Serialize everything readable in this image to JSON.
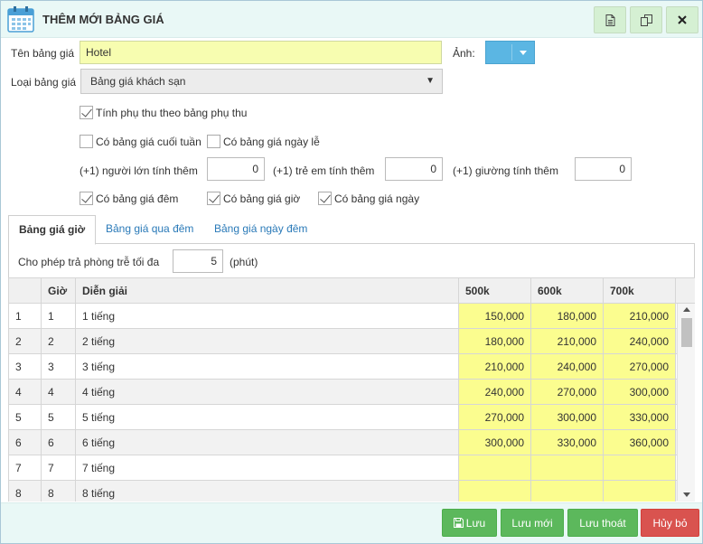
{
  "dialog": {
    "title": "THÊM MỚI BẢNG GIÁ",
    "icons": [
      "calendar-icon",
      "document-icon",
      "copy-icon",
      "close-icon"
    ]
  },
  "form": {
    "name_label": "Tên bảng giá",
    "name_value": "Hotel",
    "image_label": "Ảnh:",
    "type_label": "Loại bảng giá",
    "type_value": "Bảng giá khách sạn",
    "surcharge_label": "Tính phụ thu theo bảng phụ thu",
    "surcharge_checked": true,
    "weekend_label": "Có bảng giá cuối tuần",
    "weekend_checked": false,
    "holiday_label": "Có bảng giá ngày lễ",
    "holiday_checked": false,
    "extra_adult_label": "(+1) người lớn tính thêm",
    "extra_adult_value": "0",
    "extra_child_label": "(+1) trẻ em tính thêm",
    "extra_child_value": "0",
    "extra_bed_label": "(+1) giường tính thêm",
    "extra_bed_value": "0",
    "night_label": "Có bảng giá đêm",
    "night_checked": true,
    "hour_label": "Có bảng giá giờ",
    "hour_checked": true,
    "day_label": "Có bảng giá ngày",
    "day_checked": true
  },
  "tabs": [
    {
      "label": "Bảng giá giờ",
      "active": true
    },
    {
      "label": "Bảng giá qua đêm",
      "active": false
    },
    {
      "label": "Bảng giá ngày đêm",
      "active": false
    }
  ],
  "late_checkout": {
    "label": "Cho phép trả phòng trễ tối đa",
    "value": "5",
    "unit": "(phút)"
  },
  "table": {
    "columns": [
      "",
      "Giờ",
      "Diễn giải",
      "500k",
      "600k",
      "700k"
    ],
    "rows": [
      [
        "1",
        "1",
        "1 tiếng",
        "150,000",
        "180,000",
        "210,000"
      ],
      [
        "2",
        "2",
        "2 tiếng",
        "180,000",
        "210,000",
        "240,000"
      ],
      [
        "3",
        "3",
        "3 tiếng",
        "210,000",
        "240,000",
        "270,000"
      ],
      [
        "4",
        "4",
        "4 tiếng",
        "240,000",
        "270,000",
        "300,000"
      ],
      [
        "5",
        "5",
        "5 tiếng",
        "270,000",
        "300,000",
        "330,000"
      ],
      [
        "6",
        "6",
        "6 tiếng",
        "300,000",
        "330,000",
        "360,000"
      ],
      [
        "7",
        "7",
        "7 tiếng",
        "",
        "",
        ""
      ],
      [
        "8",
        "8",
        "8 tiếng",
        "",
        "",
        ""
      ]
    ]
  },
  "footer": {
    "save": "Lưu",
    "save_new": "Lưu mới",
    "save_exit": "Lưu thoát",
    "cancel": "Hủy bỏ"
  },
  "colors": {
    "header_bg": "#e9f8f6",
    "input_yellow": "#f7fdb0",
    "price_yellow": "#fbfd8f",
    "accent_blue": "#5bb6e3",
    "btn_green": "#5cb85c",
    "btn_red": "#d9534f",
    "link_blue": "#2a7ab8"
  }
}
